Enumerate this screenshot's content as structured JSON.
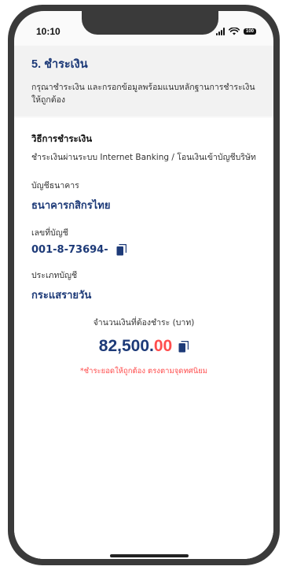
{
  "status_bar": {
    "time": "10:10",
    "battery": "100"
  },
  "header": {
    "title": "5. ชำระเงิน",
    "description": "กรุณาชำระเงิน และกรอกข้อมูลพร้อมแนบหลักฐานการชำระเงิน ให้ถูกต้อง"
  },
  "payment": {
    "method_title": "วิธีการชำระเงิน",
    "method_desc": "ชำระเงินผ่านระบบ Internet Banking / โอนเงินเข้าบัญชีบริษัท",
    "bank_label": "บัญชีธนาคาร",
    "bank_value": "ธนาคารกสิกรไทย",
    "account_no_label": "เลขที่บัญชี",
    "account_no_value": "001-8-73694-",
    "account_type_label": "ประเภทบัญชี",
    "account_type_value": "กระแสรายวัน",
    "amount_label": "จำนวนเงินที่ต้องชำระ (บาท)",
    "amount_integer": "82,500.",
    "amount_decimal": "00",
    "amount_note": "*ชำระยอดให้ถูกต้อง ตรงตามจุดทศนิยม"
  },
  "icons": {
    "copy_account": "copy-icon",
    "copy_amount": "copy-icon"
  },
  "colors": {
    "primary": "#1d3a78",
    "accent": "#ff4d4d"
  }
}
